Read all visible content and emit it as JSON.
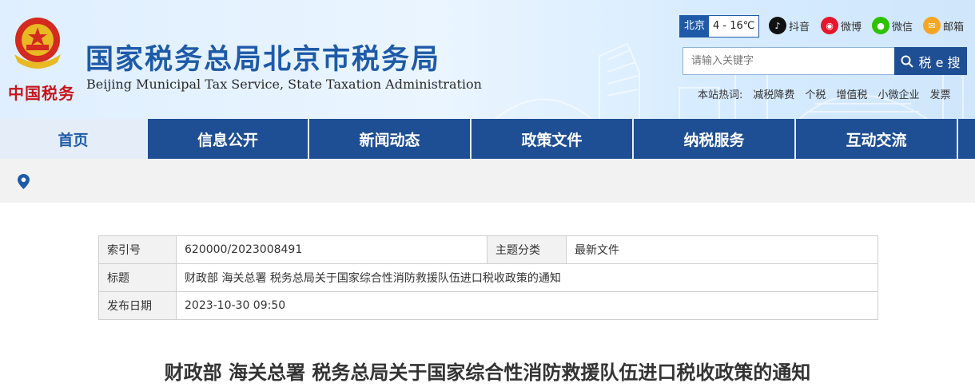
{
  "header": {
    "site_title": "国家税务总局北京市税务局",
    "site_subtitle": "Beijing Municipal Tax Service, State Taxation Administration",
    "emblem_text": "中国税务",
    "weather": {
      "city": "北京",
      "temp": "4 - 16℃"
    },
    "social": [
      {
        "label": "抖音",
        "icon": "douyin-icon",
        "color": "#111111"
      },
      {
        "label": "微博",
        "icon": "weibo-icon",
        "color": "#e6162d"
      },
      {
        "label": "微信",
        "icon": "wechat-icon",
        "color": "#2dc100"
      },
      {
        "label": "邮箱",
        "icon": "mail-icon",
        "color": "#f5a623"
      }
    ],
    "search": {
      "placeholder": "请输入关键字",
      "button_label": "税 e 搜"
    },
    "hotwords": {
      "label": "本站热词:",
      "items": [
        "减税降费",
        "个税",
        "增值税",
        "小微企业",
        "发票"
      ]
    }
  },
  "nav": {
    "items": [
      "首页",
      "信息公开",
      "新闻动态",
      "政策文件",
      "纳税服务",
      "互动交流"
    ],
    "active_index": 0
  },
  "meta": {
    "index_label": "索引号",
    "index_value": "620000/2023008491",
    "topic_label": "主题分类",
    "topic_value": "最新文件",
    "title_label": "标题",
    "title_value": "财政部 海关总署 税务总局关于国家综合性消防救援队伍进口税收政策的通知",
    "date_label": "发布日期",
    "date_value": "2023-10-30 09:50"
  },
  "document": {
    "title": "财政部 海关总署 税务总局关于国家综合性消防救援队伍进口税收政策的通知"
  },
  "colors": {
    "brand_blue": "#1e4e93",
    "title_blue": "#1e5aa8",
    "emblem_red": "#c8151b"
  }
}
